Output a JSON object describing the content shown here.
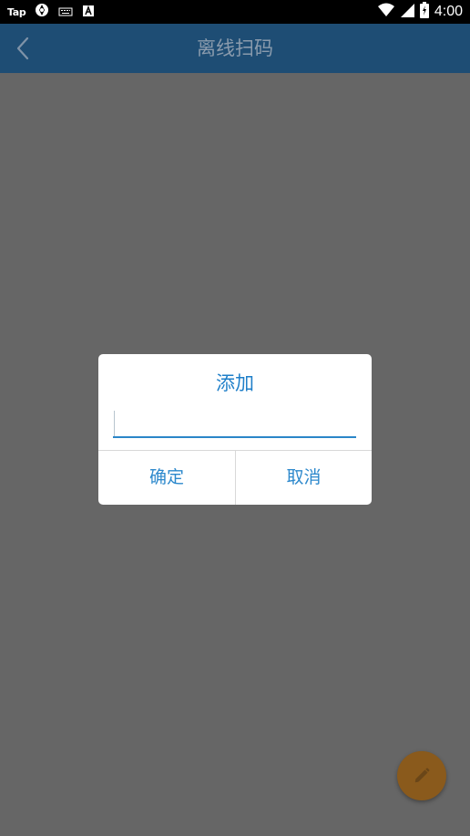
{
  "status_bar": {
    "left_app": "Tap",
    "icons": [
      "tap-icon",
      "vpn-icon",
      "keyboard-icon",
      "a-icon"
    ],
    "time": "4:00"
  },
  "app_bar": {
    "back_icon": "chevron-left-icon",
    "title": "离线扫码"
  },
  "dialog": {
    "title": "添加",
    "input_value": "",
    "input_placeholder": "",
    "confirm_label": "确定",
    "cancel_label": "取消"
  },
  "fab": {
    "icon": "pencil-icon"
  },
  "colors": {
    "app_bar": "#1e4d74",
    "scrim": "#666666",
    "accent": "#2c88cc",
    "fab": "#8a5a1c"
  }
}
